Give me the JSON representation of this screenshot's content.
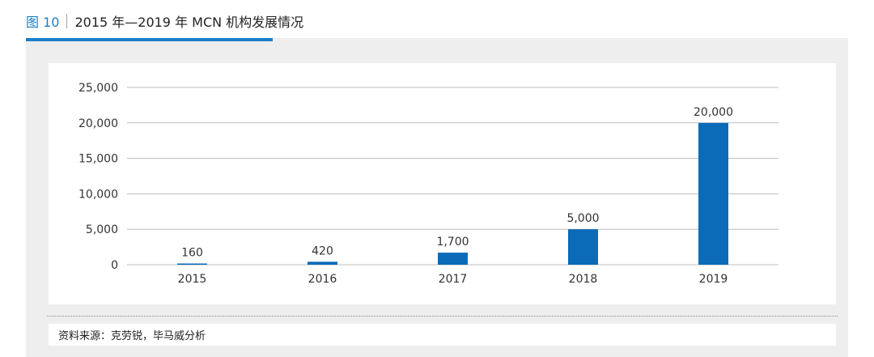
{
  "header": {
    "figure_label": "图 10",
    "title": "2015 年—2019 年 MCN 机构发展情况"
  },
  "source": {
    "text": "资料来源：克劳锐，毕马威分析"
  },
  "colors": {
    "accent": "#1a7fc7",
    "bar": "#0b6bb8",
    "panel": "#eeeeee",
    "grid": "#bdbdbd"
  },
  "chart_data": {
    "type": "bar",
    "categories": [
      "2015",
      "2016",
      "2017",
      "2018",
      "2019"
    ],
    "values": [
      160,
      420,
      1700,
      5000,
      20000
    ],
    "value_labels": [
      "160",
      "420",
      "1,700",
      "5,000",
      "20,000"
    ],
    "ylim": [
      0,
      25000
    ],
    "yticks": [
      0,
      5000,
      10000,
      15000,
      20000,
      25000
    ],
    "ytick_labels": [
      "0",
      "5,000",
      "10,000",
      "15,000",
      "20,000",
      "25,000"
    ],
    "grid": true
  }
}
